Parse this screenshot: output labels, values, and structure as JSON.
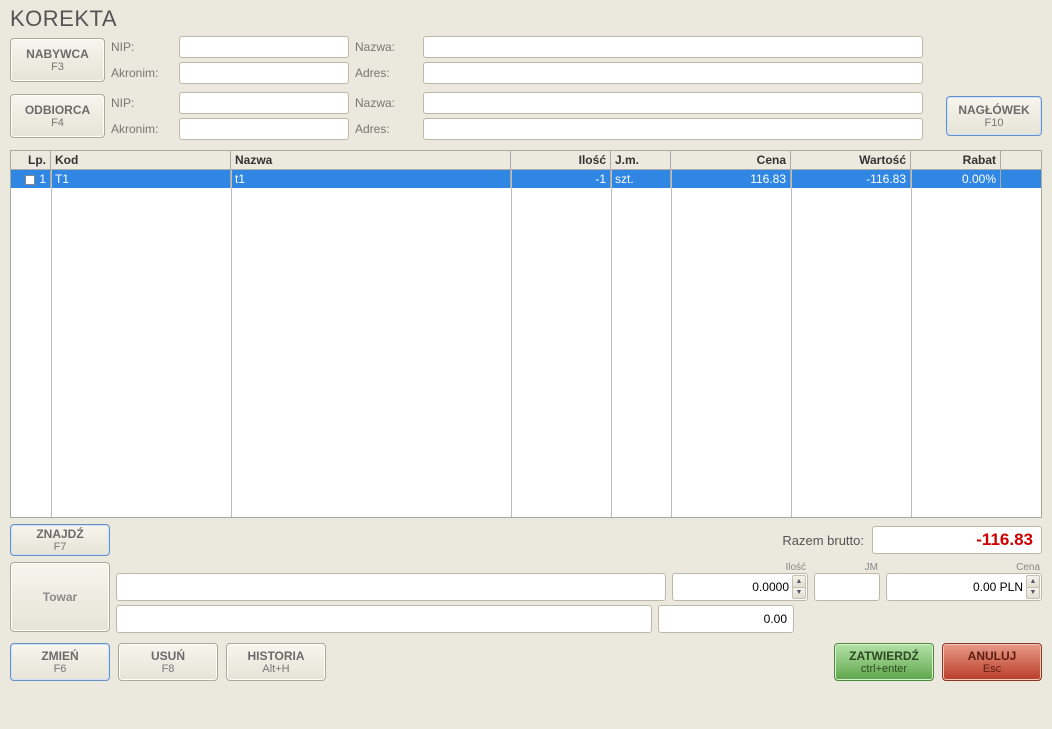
{
  "title": "KOREKTA",
  "buyer": {
    "button_label": "NABYWCA",
    "button_sub": "F3",
    "nip_label": "NIP:",
    "nip_value": "",
    "akronim_label": "Akronim:",
    "akronim_value": "",
    "nazwa_label": "Nazwa:",
    "nazwa_value": "",
    "adres_label": "Adres:",
    "adres_value": ""
  },
  "recipient": {
    "button_label": "ODBIORCA",
    "button_sub": "F4",
    "nip_label": "NIP:",
    "nip_value": "",
    "akronim_label": "Akronim:",
    "akronim_value": "",
    "nazwa_label": "Nazwa:",
    "nazwa_value": "",
    "adres_label": "Adres:",
    "adres_value": ""
  },
  "header_button": {
    "label": "NAGŁÓWEK",
    "sub": "F10"
  },
  "grid": {
    "columns": {
      "lp": "Lp.",
      "kod": "Kod",
      "nazwa": "Nazwa",
      "ilosc": "Ilość",
      "jm": "J.m.",
      "cena": "Cena",
      "wartosc": "Wartość",
      "rabat": "Rabat"
    },
    "rows": [
      {
        "lp": "1",
        "kod": "T1",
        "nazwa": "t1",
        "ilosc": "-1",
        "jm": "szt.",
        "cena": "116.83",
        "wartosc": "-116.83",
        "rabat": "0.00%"
      }
    ]
  },
  "find_button": {
    "label": "ZNAJDŹ",
    "sub": "F7"
  },
  "total": {
    "label": "Razem brutto:",
    "value": "-116.83"
  },
  "item": {
    "towar_label": "Towar",
    "ilosc_label": "Ilość",
    "jm_label": "JM",
    "cena_label": "Cena",
    "nazwa_value": "",
    "kod_value": "",
    "ilosc_value": "0.0000",
    "jm_value": "",
    "cena_value": "0.00 PLN",
    "sum_value": "0.00"
  },
  "actions": {
    "zmien": {
      "label": "ZMIEŃ",
      "sub": "F6"
    },
    "usun": {
      "label": "USUŃ",
      "sub": "F8"
    },
    "historia": {
      "label": "HISTORIA",
      "sub": "Alt+H"
    },
    "zatwierdz": {
      "label": "ZATWIERDŹ",
      "sub": "ctrl+enter"
    },
    "anuluj": {
      "label": "ANULUJ",
      "sub": "Esc"
    }
  }
}
